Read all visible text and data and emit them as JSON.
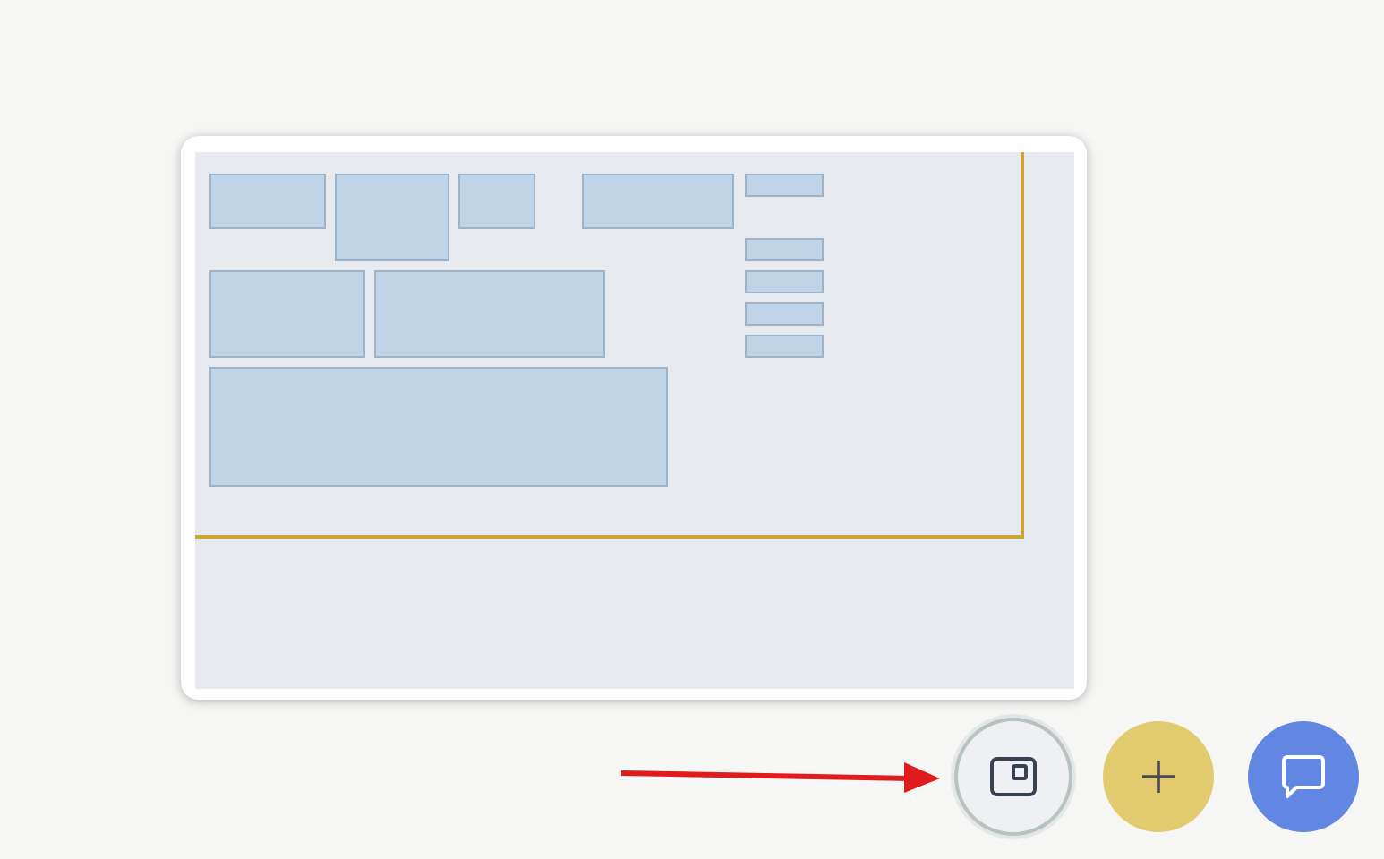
{
  "minimap": {
    "open": true
  },
  "buttons": [
    {
      "kind": "minimap",
      "selected": true
    },
    {
      "kind": "add",
      "selected": false
    },
    {
      "kind": "chat",
      "selected": false
    }
  ]
}
